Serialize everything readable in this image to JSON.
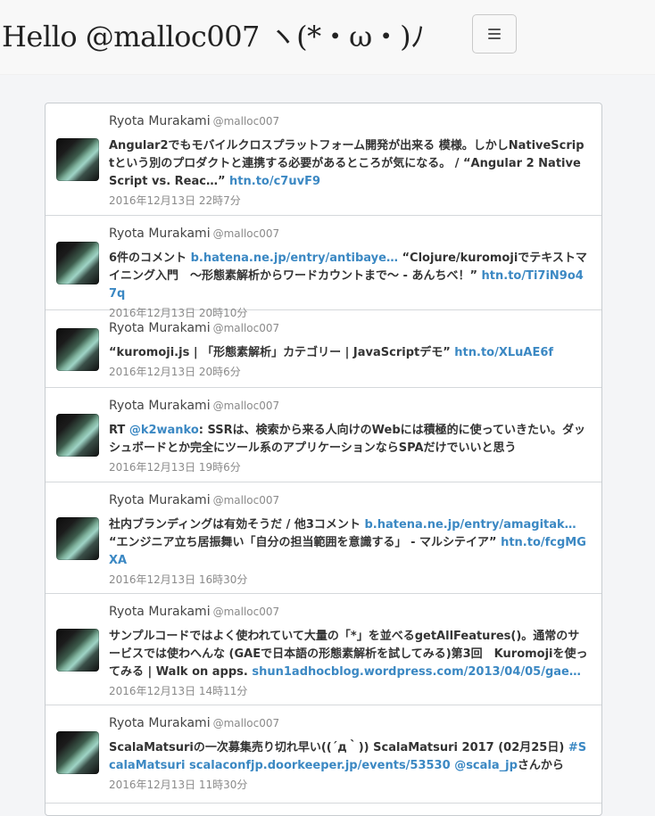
{
  "header": {
    "brand": "Hello @malloc007 ヽ(*・ω・)ﾉ",
    "menu_icon": "hamburger-icon"
  },
  "tweets": [
    {
      "name": "Ryota Murakami",
      "handle": "@malloc007",
      "avatar_icon": "user-avatar",
      "segments": [
        {
          "text": "Angular2でもモバイルクロスプラットフォーム開発が出来る 模様。しかしNativeScriptという別のプロダクトと連携する必要があるところが気になる。 / “Angular 2 NativeScript vs. Reac…” ",
          "link": false
        },
        {
          "text": "htn.to/c7uvF9",
          "link": true
        }
      ],
      "time": "2016年12月13日 22時7分"
    },
    {
      "name": "Ryota Murakami",
      "handle": "@malloc007",
      "avatar_icon": "user-avatar",
      "segments": [
        {
          "text": "6件のコメント ",
          "link": false
        },
        {
          "text": "b.hatena.ne.jp/entry/antibaye…",
          "link": true
        },
        {
          "text": " “Clojure/kuromojiでテキストマイニング入門　〜形態素解析からワードカウントまで〜 - あんちべ！” ",
          "link": false
        },
        {
          "text": "htn.to/Ti7iN9o47q",
          "link": true
        }
      ],
      "time": "2016年12月13日 20時10分"
    },
    {
      "name": "Ryota Murakami",
      "handle": "@malloc007",
      "avatar_icon": "user-avatar",
      "segments": [
        {
          "text": "“kuromoji.js | 「形態素解析」カテゴリー | JavaScriptデモ” ",
          "link": false
        },
        {
          "text": "htn.to/XLuAE6f",
          "link": true
        }
      ],
      "time": "2016年12月13日 20時6分"
    },
    {
      "name": "Ryota Murakami",
      "handle": "@malloc007",
      "avatar_icon": "user-avatar",
      "segments": [
        {
          "text": "RT ",
          "link": false
        },
        {
          "text": "@k2wanko",
          "link": true
        },
        {
          "text": ": SSRは、検索から来る人向けのWebには積極的に使っていきたい。ダッシュボードとか完全にツール系のアプリケーションならSPAだけでいいと思う",
          "link": false
        }
      ],
      "time": "2016年12月13日 19時6分"
    },
    {
      "name": "Ryota Murakami",
      "handle": "@malloc007",
      "avatar_icon": "user-avatar",
      "segments": [
        {
          "text": "社内ブランディングは有効そうだ / 他3コメント ",
          "link": false
        },
        {
          "text": "b.hatena.ne.jp/entry/amagitak…",
          "link": true
        },
        {
          "text": " “エンジニア立ち居振舞い「自分の担当範囲を意識する」 - マルシテイア” ",
          "link": false
        },
        {
          "text": "htn.to/fcgMGXA",
          "link": true
        }
      ],
      "time": "2016年12月13日 16時30分"
    },
    {
      "name": "Ryota Murakami",
      "handle": "@malloc007",
      "avatar_icon": "user-avatar",
      "segments": [
        {
          "text": "サンプルコードではよく使われていて大量の「*」を並べるgetAllFeatures()。通常のサービスでは使わへんな (GAEで日本語の形態素解析を試してみる)第3回　Kuromojiを使ってみる | Walk on apps. ",
          "link": false
        },
        {
          "text": "shun1adhocblog.wordpress.com/2013/04/05/gae…",
          "link": true
        }
      ],
      "time": "2016年12月13日 14時11分"
    },
    {
      "name": "Ryota Murakami",
      "handle": "@malloc007",
      "avatar_icon": "user-avatar",
      "segments": [
        {
          "text": "ScalaMatsuriの一次募集売り切れ早い((´д｀)) ScalaMatsuri 2017 (02月25日) ",
          "link": false
        },
        {
          "text": "#ScalaMatsuri",
          "link": true
        },
        {
          "text": " ",
          "link": false
        },
        {
          "text": "scalaconfjp.doorkeeper.jp/events/53530",
          "link": true
        },
        {
          "text": " ",
          "link": false
        },
        {
          "text": "@scala_jp",
          "link": true
        },
        {
          "text": "さんから",
          "link": false
        }
      ],
      "time": "2016年12月13日 11時30分"
    }
  ]
}
